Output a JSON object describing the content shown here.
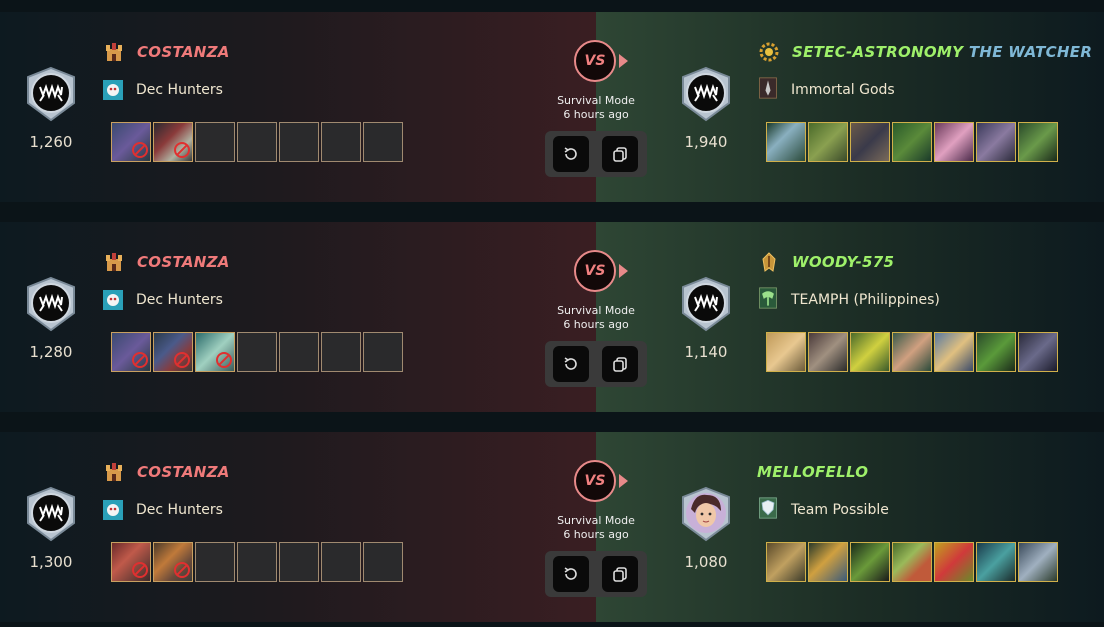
{
  "battles": [
    {
      "left": {
        "name": "COSTANZA",
        "guild": "Dec Hunters",
        "rating": "1,260",
        "cards_filled": 2,
        "cards_total": 7
      },
      "mode": "Survival Mode",
      "time": "6 hours ago",
      "vs": "VS",
      "right": {
        "name": "SETEC-ASTRONOMY",
        "title": "THE WATCHER",
        "guild": "Immortal Gods",
        "rating": "1,940",
        "cards_filled": 7
      }
    },
    {
      "left": {
        "name": "COSTANZA",
        "guild": "Dec Hunters",
        "rating": "1,280",
        "cards_filled": 3,
        "cards_total": 7
      },
      "mode": "Survival Mode",
      "time": "6 hours ago",
      "vs": "VS",
      "right": {
        "name": "WOODY-575",
        "title": "",
        "guild": "TEAMPH (Philippines)",
        "rating": "1,140",
        "cards_filled": 7
      }
    },
    {
      "left": {
        "name": "COSTANZA",
        "guild": "Dec Hunters",
        "rating": "1,300",
        "cards_filled": 2,
        "cards_total": 7
      },
      "mode": "Survival Mode",
      "time": "6 hours ago",
      "vs": "VS",
      "right": {
        "name": "MELLOFELLO",
        "title": "",
        "guild": "Team Possible",
        "rating": "1,080",
        "cards_filled": 7
      }
    }
  ],
  "colors": {
    "left_name": "#f07a7a",
    "right_name": "#9ef06a",
    "title": "#7fb8d6",
    "vs": "#e88a8a"
  },
  "icons": {
    "rank": "champion-league-badge-icon",
    "replay": "replay-icon",
    "copy": "copy-team-icon",
    "left_player_icon": "castle-emblem-icon",
    "right_player_icons": [
      "gear-sun-icon",
      "golden-crest-icon",
      "avatar-icon"
    ]
  }
}
